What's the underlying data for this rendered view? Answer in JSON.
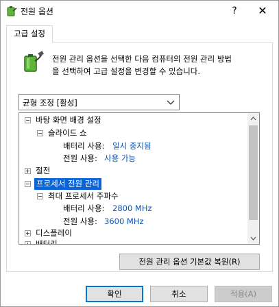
{
  "window": {
    "title": "전원 옵션",
    "help_glyph": "?",
    "close_glyph": "✕"
  },
  "tab": {
    "label": "고급 설정"
  },
  "description": {
    "line1": "전원 관리 옵션을 선택한 다음 컴퓨터의 전원 관리 방법",
    "line2": "을 선택하여 고급 설정을 변경할 수 있습니다."
  },
  "plan_select": {
    "value": "균형 조정 [활성]"
  },
  "tree": {
    "items": [
      {
        "label": "바탕 화면 배경 설정",
        "expander": "minus"
      },
      {
        "label": "슬라이드 쇼",
        "expander": "minus"
      },
      {
        "label": "배터리 사용:",
        "value": "일시 중지됨"
      },
      {
        "label": "전원 사용:",
        "value": "사용 가능"
      },
      {
        "label": "절전",
        "expander": "plus"
      },
      {
        "label": "프로세서 전원 관리",
        "expander": "minus",
        "selected": true
      },
      {
        "label": "최대 프로세서 주파수",
        "expander": "minus"
      },
      {
        "label": "배터리 사용:",
        "value": "2800 MHz"
      },
      {
        "label": "전원 사용:",
        "value": "3600 MHz"
      },
      {
        "label": "디스플레이",
        "expander": "plus"
      },
      {
        "label": "배터리",
        "expander": "plus"
      }
    ]
  },
  "buttons": {
    "restore": "전원 관리 옵션 기본값 복원(R)",
    "ok": "확인",
    "cancel": "취소",
    "apply": "적용(A)"
  },
  "colors": {
    "selection": "#0a64d6",
    "value_text": "#0b53b3",
    "ok_border": "#0078d7"
  }
}
